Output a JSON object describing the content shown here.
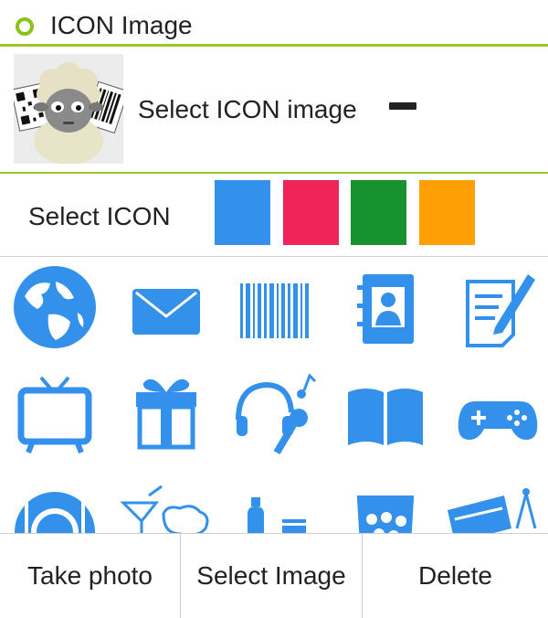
{
  "header": {
    "title": "ICON Image",
    "accent": "#9cc626"
  },
  "icon_image": {
    "label": "Select ICON image",
    "remove_icon": "minus-icon"
  },
  "icon_color": {
    "label": "Select ICON",
    "swatches": [
      {
        "name": "blue",
        "color": "#3391ec"
      },
      {
        "name": "red",
        "color": "#ef2458"
      },
      {
        "name": "green",
        "color": "#18922e"
      },
      {
        "name": "orange",
        "color": "#ff9f06"
      }
    ]
  },
  "icons": [
    "globe-icon",
    "mail-icon",
    "barcode-icon",
    "address-book-icon",
    "memo-edit-icon",
    "tv-icon",
    "gift-icon",
    "headphones-music-icon",
    "book-icon",
    "gamepad-icon",
    "dining-icon",
    "cocktail-icon",
    "bottles-icon",
    "snack-bag-icon",
    "ruler-compass-icon"
  ],
  "icon_color_active": "#3391ec",
  "actions": {
    "take_photo": "Take photo",
    "select_image": "Select Image",
    "delete": "Delete"
  }
}
